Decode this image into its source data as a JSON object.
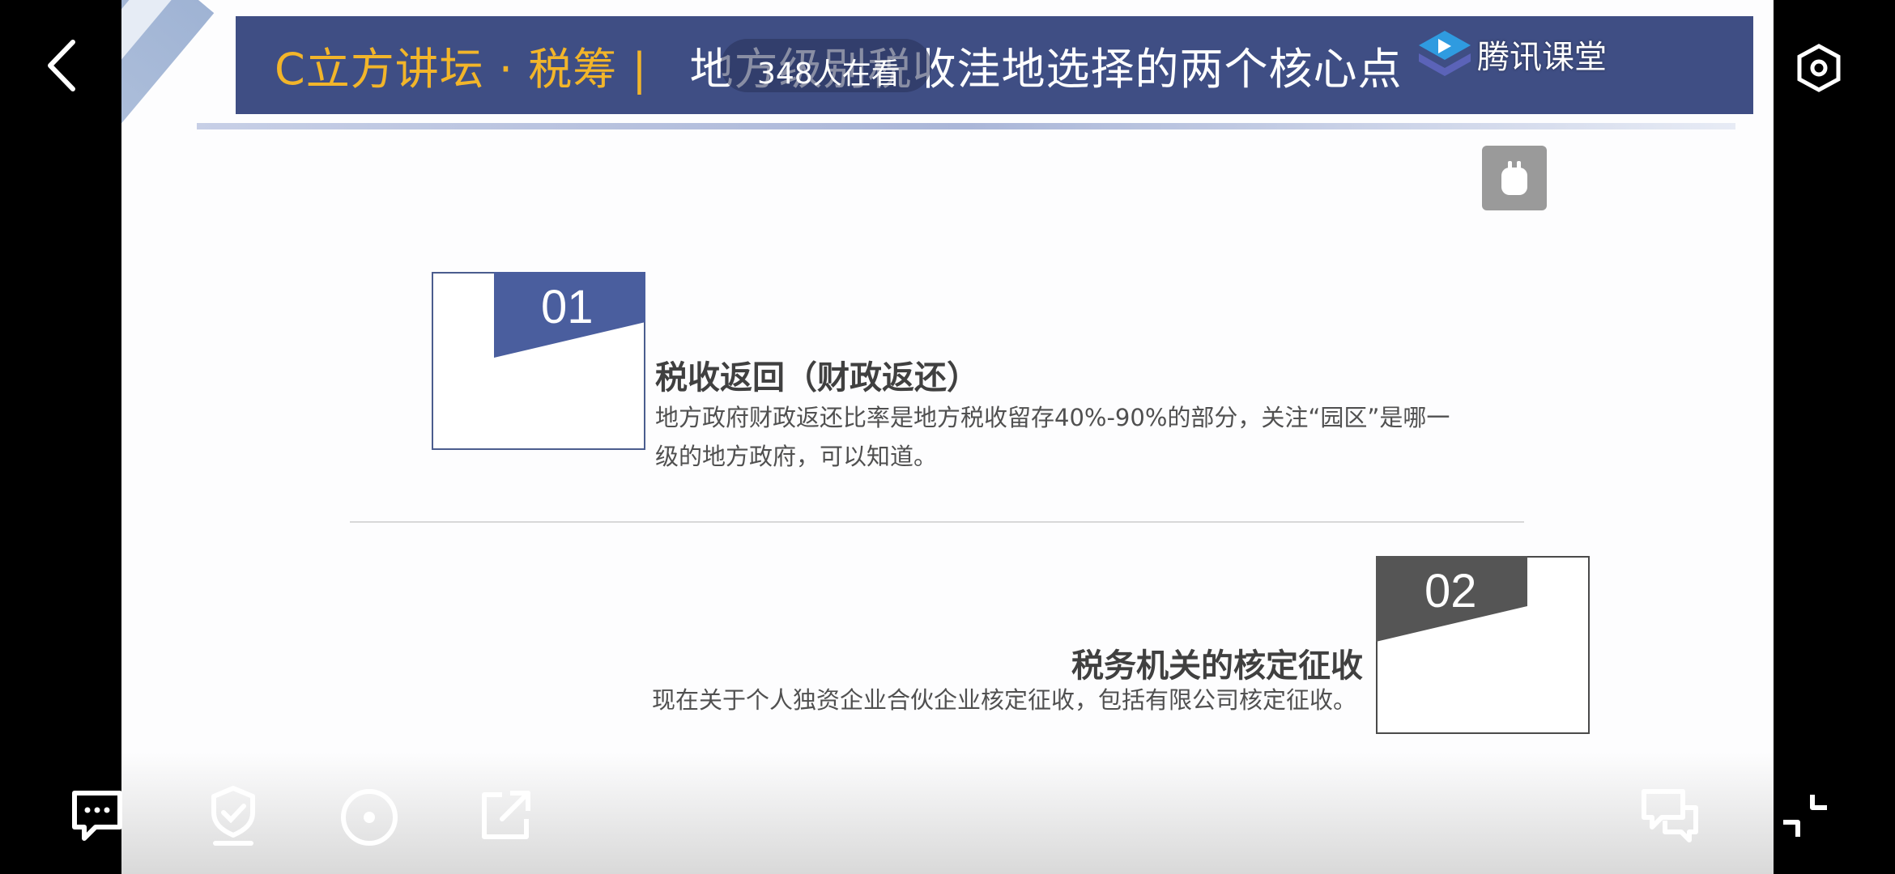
{
  "slide": {
    "brand": "C立方讲坛 · 税筹 |",
    "title": "地方级别税收洼地选择的两个核心点",
    "viewer_count": "348人在看",
    "tencent_brand": "腾讯课堂",
    "items": [
      {
        "number": "01",
        "heading": "税收返回（财政返还）",
        "text": "地方政府财政返还比率是地方税收留存40%-90%的部分，关注“园区”是哪一级的地方政府，可以知道。"
      },
      {
        "number": "02",
        "heading": "税务机关的核定征收",
        "text": "现在关于个人独资企业合伙企业核定征收，包括有限公司核定征收。"
      }
    ]
  },
  "colors": {
    "title_bar": "#3f4e84",
    "brand_text": "#f2b52a",
    "num_block_1": "#4a5e9e",
    "num_block_2": "#555555"
  },
  "icons": {
    "back": "back-arrow-icon",
    "settings": "hexagon-settings-icon",
    "chat": "chat-bubble-icon",
    "badge": "shield-badge-icon",
    "target": "circle-dot-icon",
    "share": "share-icon",
    "comment": "comments-icon",
    "exit_fullscreen": "exit-fullscreen-icon"
  }
}
